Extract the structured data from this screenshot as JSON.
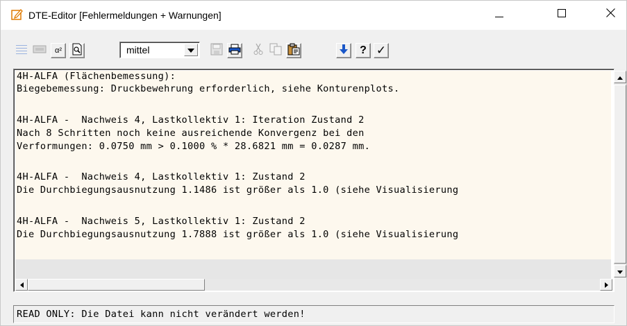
{
  "window": {
    "title": "DTE-Editor [Fehlermeldungen + Warnungen]",
    "minimize_symbol": "—",
    "maximize_symbol": "☐",
    "close_symbol": "✕"
  },
  "toolbar": {
    "superscript_label": "α²",
    "font_size_value": "mittel",
    "help_label": "?",
    "check_label": "✓",
    "icons": [
      "grid-lines-icon",
      "keyboard-icon",
      "superscript-icon",
      "print-preview-icon",
      "save-icon",
      "print-icon",
      "cut-icon",
      "copy-icon",
      "paste-icon",
      "arrow-down-icon",
      "help-icon",
      "check-icon"
    ]
  },
  "editor": {
    "lines": [
      "4H-ALFA (Flächenbemessung):",
      "Biegebemessung: Druckbewehrung erforderlich, siehe Konturenplots.",
      "",
      "4H-ALFA -  Nachweis 4, Lastkollektiv 1: Iteration Zustand 2",
      "Nach 8 Schritten noch keine ausreichende Konvergenz bei den",
      "Verformungen: 0.0750 mm > 0.1000 % * 28.6821 mm = 0.0287 mm.",
      "",
      "4H-ALFA -  Nachweis 4, Lastkollektiv 1: Zustand 2",
      "Die Durchbiegungsausnutzung 1.1486 ist größer als 1.0 (siehe Visualisierung",
      "",
      "4H-ALFA -  Nachweis 5, Lastkollektiv 1: Zustand 2",
      "Die Durchbiegungsausnutzung 1.7888 ist größer als 1.0 (siehe Visualisierung"
    ]
  },
  "statusbar": {
    "text": "READ ONLY: Die Datei kann nicht verändert werden!"
  },
  "colors": {
    "editor_background": "#fdf8ee",
    "icon_blue": "#1a57c8",
    "disabled_icon": "#a8a8a8"
  }
}
